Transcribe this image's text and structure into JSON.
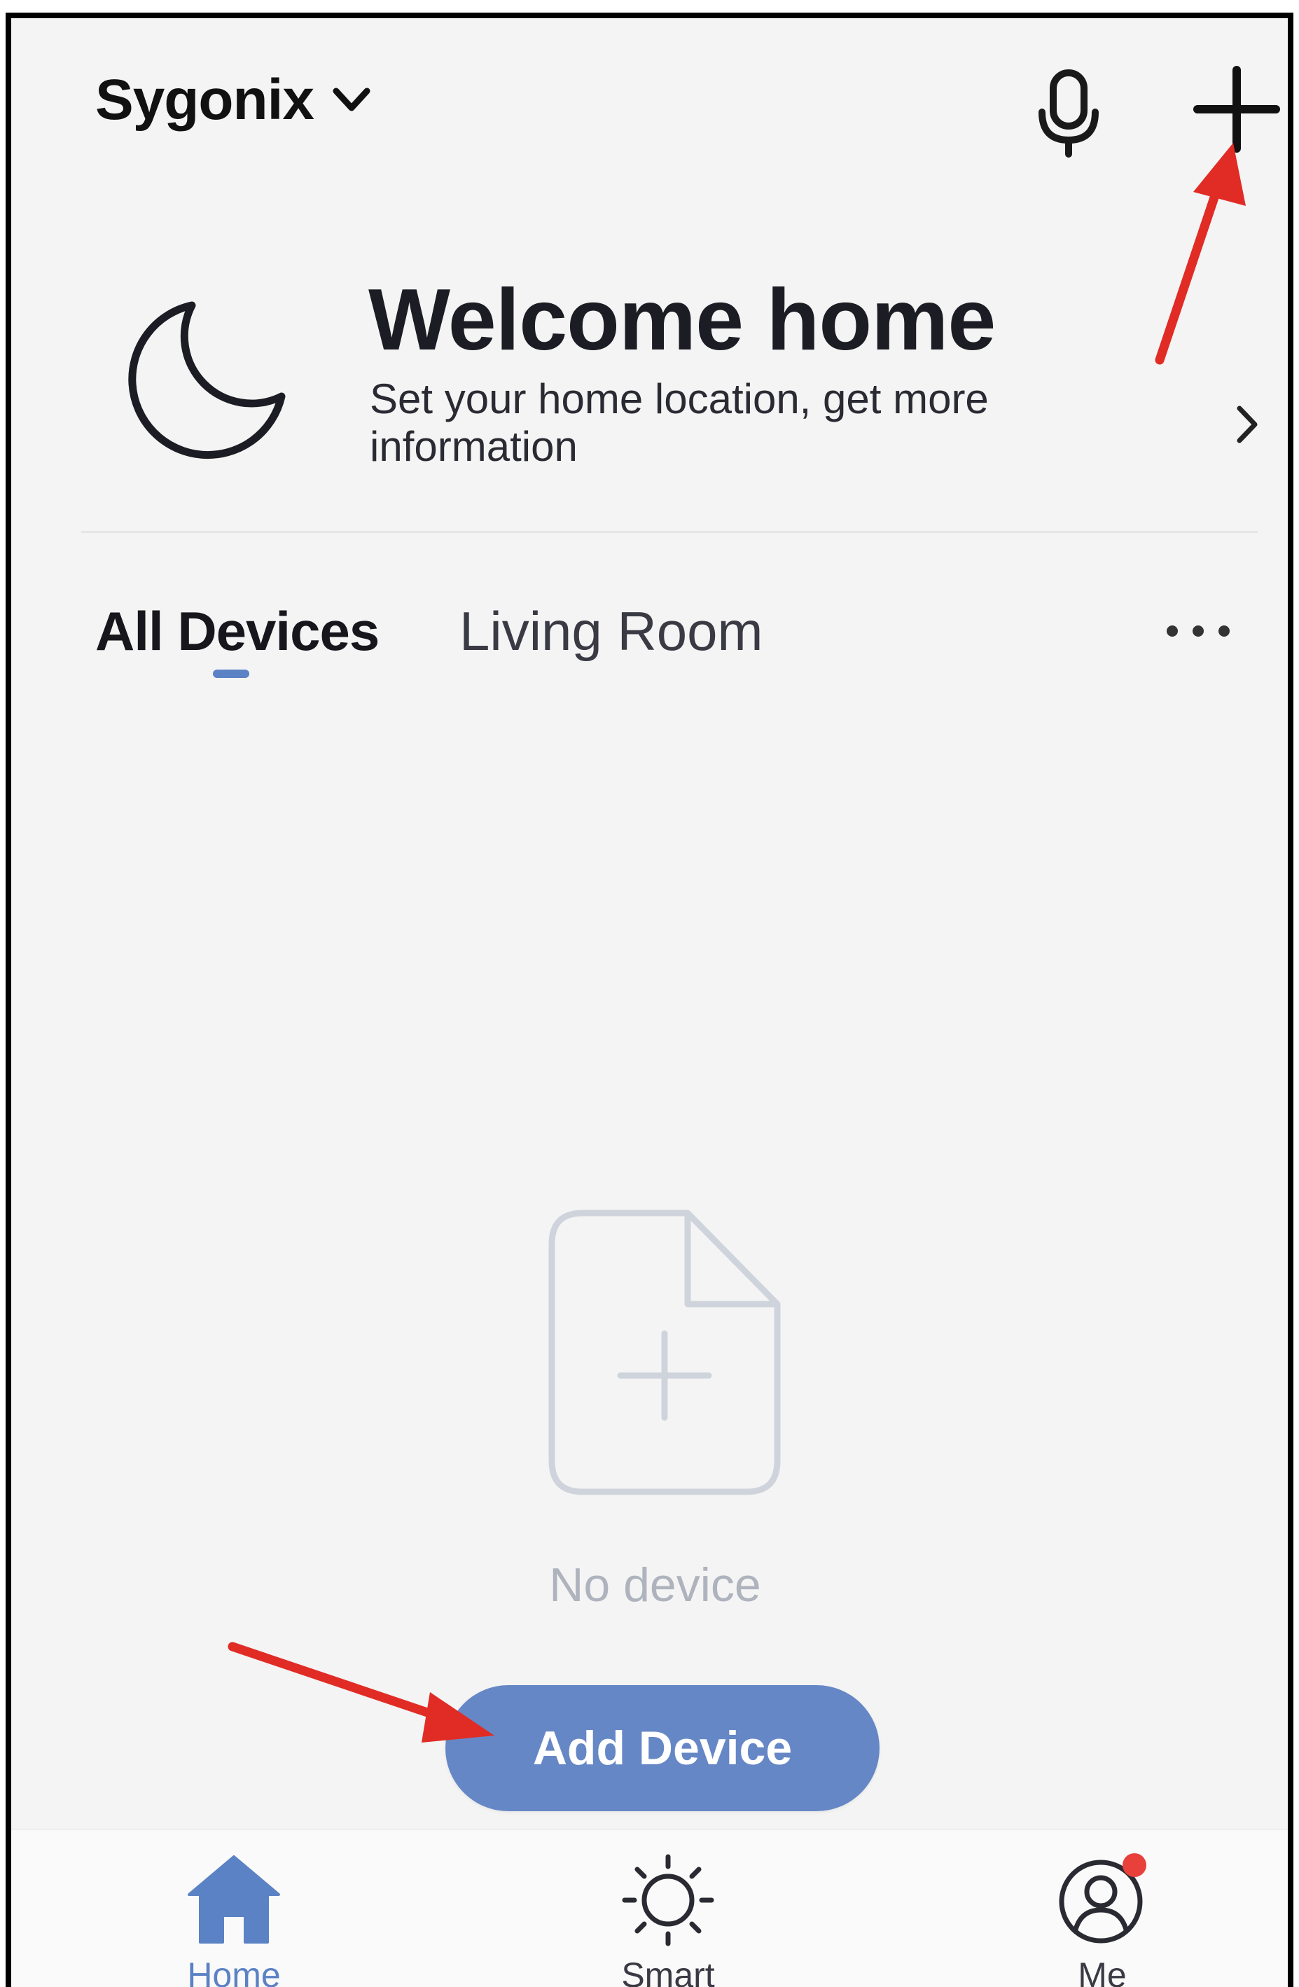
{
  "header": {
    "home_name": "Sygonix",
    "icons": [
      "chevron-down-icon",
      "microphone-icon",
      "plus-icon"
    ]
  },
  "banner": {
    "title": "Welcome home",
    "subtitle": "Set your home location, get more information",
    "icons": [
      "moon-icon",
      "chevron-right-icon"
    ]
  },
  "tabs": [
    {
      "label": "All Devices",
      "selected": true
    },
    {
      "label": "Living Room",
      "selected": false
    }
  ],
  "empty_state": {
    "message": "No device",
    "button_label": "Add Device",
    "icon": "add-file-icon"
  },
  "bottom_nav": [
    {
      "label": "Home",
      "icon": "home-icon",
      "active": true
    },
    {
      "label": "Smart",
      "icon": "sun-icon",
      "active": false
    },
    {
      "label": "Me",
      "icon": "user-icon",
      "active": false,
      "badge": true
    }
  ],
  "colors": {
    "accent": "#5b82c4",
    "button": "#6687c6",
    "background": "#f4f4f4",
    "badge": "#e8403a",
    "annotation_arrow": "#e02c25"
  }
}
